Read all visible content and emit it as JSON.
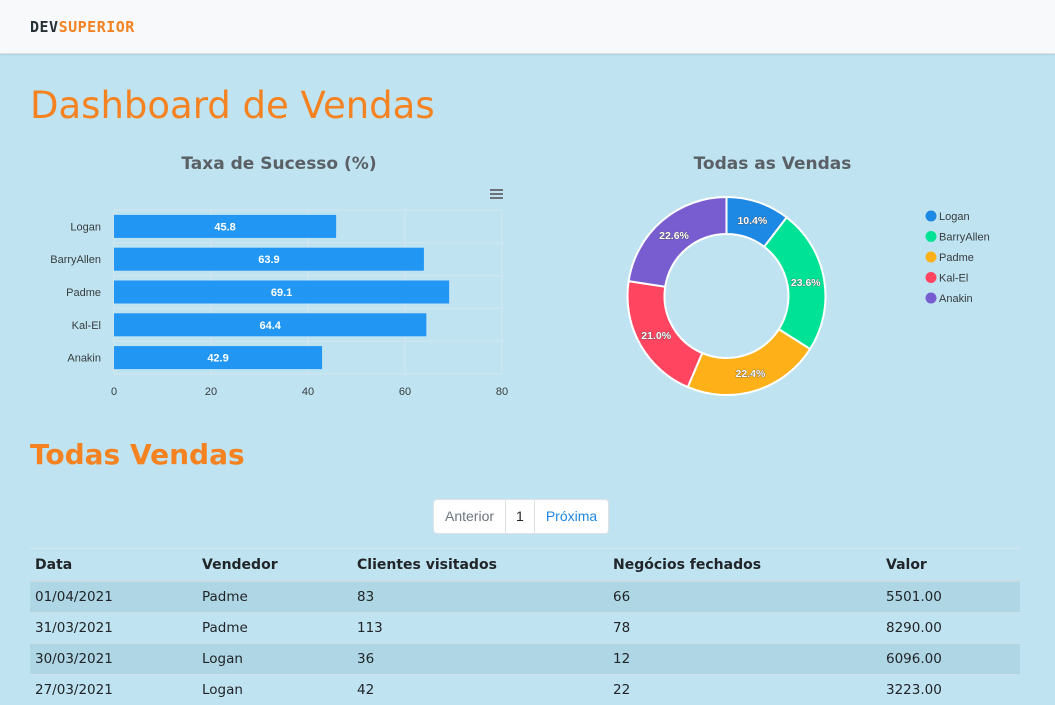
{
  "brand": {
    "part1": "DEV",
    "part2": "SUPERIOR"
  },
  "page_title": "Dashboard de Vendas",
  "section_title": "Todas Vendas",
  "pagination": {
    "prev": "Anterior",
    "current": "1",
    "next": "Próxima"
  },
  "table": {
    "headers": [
      "Data",
      "Vendedor",
      "Clientes visitados",
      "Negócios fechados",
      "Valor"
    ],
    "rows": [
      [
        "01/04/2021",
        "Padme",
        "83",
        "66",
        "5501.00"
      ],
      [
        "31/03/2021",
        "Padme",
        "113",
        "78",
        "8290.00"
      ],
      [
        "30/03/2021",
        "Logan",
        "36",
        "12",
        "6096.00"
      ],
      [
        "27/03/2021",
        "Logan",
        "42",
        "22",
        "3223.00"
      ]
    ]
  },
  "icons": {
    "chart_menu": "hamburger-menu-icon"
  },
  "colors": {
    "accent": "#f58220",
    "bar": "#2196f3",
    "background": "#bfe3f0"
  },
  "chart_data": [
    {
      "type": "bar",
      "orientation": "horizontal",
      "title": "Taxa de Sucesso (%)",
      "categories": [
        "Logan",
        "BarryAllen",
        "Padme",
        "Kal-El",
        "Anakin"
      ],
      "values": [
        45.8,
        63.9,
        69.1,
        64.4,
        42.9
      ],
      "xlim": [
        0,
        80
      ],
      "xticks": [
        "0",
        "20",
        "40",
        "60",
        "80"
      ],
      "grid": true,
      "color": "#2196f3"
    },
    {
      "type": "pie",
      "donut": true,
      "title": "Todas as Vendas",
      "labels": [
        "Logan",
        "BarryAllen",
        "Padme",
        "Kal-El",
        "Anakin"
      ],
      "values": [
        10.4,
        23.6,
        22.4,
        21.0,
        22.6
      ],
      "value_labels": [
        "10.4%",
        "23.6%",
        "22.4%",
        "21.0%",
        "22.6%"
      ],
      "colors": [
        "#1e88e5",
        "#00e396",
        "#feb019",
        "#ff4560",
        "#775dd0"
      ],
      "legend": "right"
    }
  ]
}
